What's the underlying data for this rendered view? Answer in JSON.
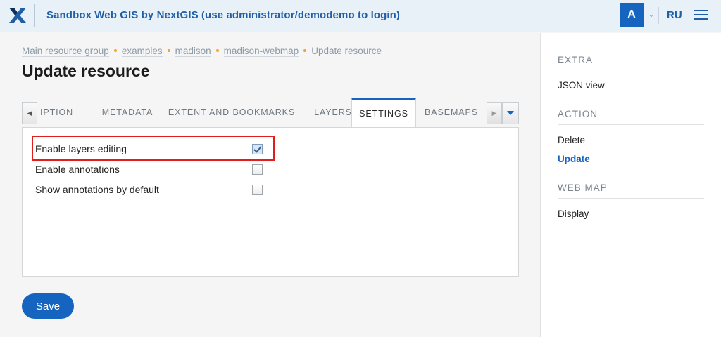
{
  "header": {
    "logo_icon": "nextgis-x-logo-icon",
    "title": "Sandbox Web GIS by NextGIS (use administrator/demodemo to login)",
    "avatar_letter": "A",
    "language": "RU",
    "brand_color": "#1565c0"
  },
  "breadcrumb": {
    "items": [
      "Main resource group",
      "examples",
      "madison",
      "madison-webmap",
      "Update resource"
    ]
  },
  "page": {
    "title": "Update resource"
  },
  "tabs": {
    "items": [
      "IPTION",
      "METADATA",
      "EXTENT AND BOOKMARKS",
      "LAYERS",
      "SETTINGS",
      "BASEMAPS"
    ],
    "active": "SETTINGS"
  },
  "settings": {
    "fields": [
      {
        "label": "Enable layers editing",
        "checked": true
      },
      {
        "label": "Enable annotations",
        "checked": false
      },
      {
        "label": "Show annotations by default",
        "checked": false
      }
    ]
  },
  "actions": {
    "save_label": "Save"
  },
  "sidebar": {
    "sections": [
      {
        "heading": "EXTRA",
        "items": [
          "JSON view"
        ]
      },
      {
        "heading": "ACTION",
        "items": [
          "Delete",
          "Update"
        ]
      },
      {
        "heading": "WEB MAP",
        "items": [
          "Display"
        ]
      }
    ],
    "active_item": "Update"
  }
}
